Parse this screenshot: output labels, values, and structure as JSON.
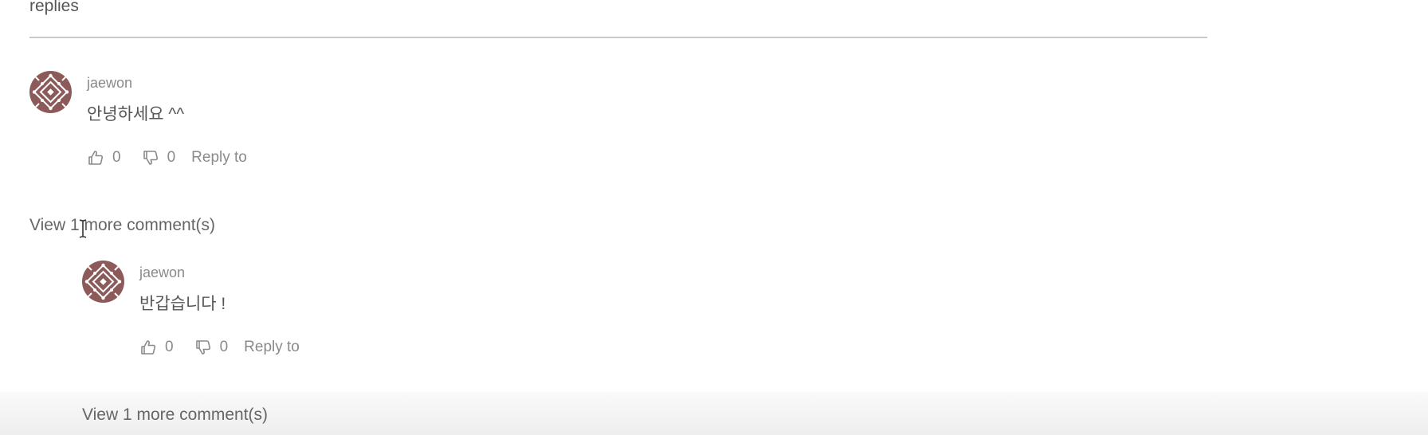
{
  "section": {
    "title": "replies"
  },
  "comments": [
    {
      "author": "jaewon",
      "text": "안녕하세요 ^^",
      "likes": "0",
      "dislikes": "0",
      "reply_label": "Reply to"
    },
    {
      "author": "jaewon",
      "text": "반갑습니다 !",
      "likes": "0",
      "dislikes": "0",
      "reply_label": "Reply to"
    }
  ],
  "view_more": [
    {
      "label": "View 1 more comment(s)"
    },
    {
      "label": "View 1 more comment(s)"
    }
  ],
  "colors": {
    "avatar": "#8d5a5a",
    "text": "#555555",
    "muted": "#8a8a8a",
    "divider": "#c9c9c9"
  },
  "icons": [
    "avatar-pattern",
    "thumbs-up-icon",
    "thumbs-down-icon",
    "text-cursor-icon"
  ]
}
